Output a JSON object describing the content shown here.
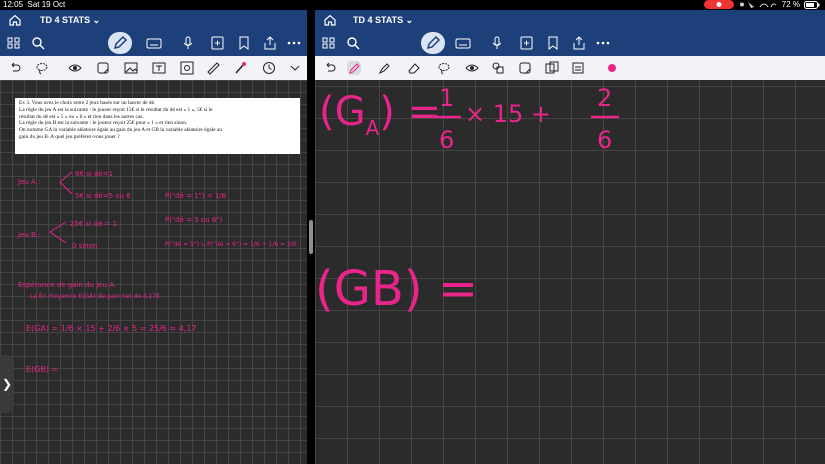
{
  "status": {
    "time": "12:05",
    "date": "Sat 19 Oct",
    "battery": "72 %"
  },
  "left_pane": {
    "doc_tab": "TD 4 STATS ⌄",
    "exercise": {
      "heading": "Ex 3.",
      "lines": [
        "Ex 3. Vous avez le choix entre 2 jeux basés sur un lancer de dé.",
        "La règle du jeu A est la suivante : le joueur reçoit 15€ si le résultat du dé est « 1 », 5€ si le",
        "résultat du dé est « 5 » ou « 6 » et rien dans les autres cas.",
        "La règle du jeu B est la suivante : le joueur reçoit 25€ pour « 1 » et rien sinon.",
        "On nomme GA la variable aléatoire égale au gain du jeu A et GB la variable aléatoire égale au",
        "gain du jeu B. A quel jeu préférez-vous jouer ?"
      ]
    },
    "handwriting": {
      "jeuA": "Jeu A :",
      "a1": "6€ si dé=1",
      "a2": "5€ si dé=5 ou 6",
      "pa1": "P(\"dé = 1\") = 1/6",
      "pa2": "P(\"dé = 5 ou 6\")",
      "jeuB": "Jeu B :",
      "b1": "25€ si dé = 1",
      "b2": "0 sinon",
      "pb": "P(\"dé = 5\") ∪ P(\"dé = 6\") = 1/6 + 1/6 = 2/6",
      "esp": "Espérance de gain du jeu A.",
      "esp2": "La En moyenne E(GA) de gain net de 4,17€",
      "eq1": "E(GA) = 1/6 × 15 + 2/6 × 5 = 25/6 ≈ 4,17",
      "eq2": "E(GB) ="
    }
  },
  "right_pane": {
    "doc_tab": "TD 4 STATS ⌄",
    "handwriting": {
      "eqA": "(GA) = 1/6 × 15 + 2/6",
      "eqB": "(GB) ="
    }
  },
  "side_tab": "❯",
  "colors": {
    "ink": "#e8258a",
    "ribbon": "#1d3f7a",
    "canvas": "#2b2b2b"
  }
}
